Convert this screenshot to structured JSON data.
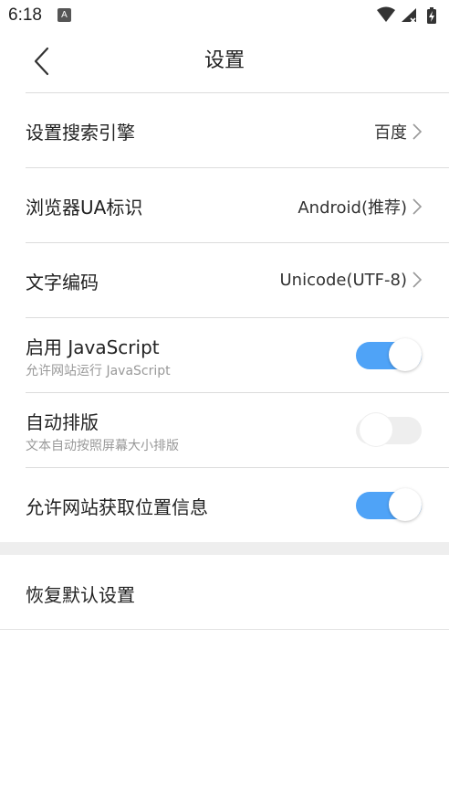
{
  "status": {
    "time": "6:18",
    "app_icon_text": "A"
  },
  "header": {
    "title": "设置"
  },
  "settings": [
    {
      "label": "设置搜索引擎",
      "value": "百度"
    },
    {
      "label": "浏览器UA标识",
      "value": "Android(推荐)"
    },
    {
      "label": "文字编码",
      "value": "Unicode(UTF-8)"
    },
    {
      "label": "启用 JavaScript",
      "sub": "允许网站运行 JavaScript",
      "enabled": true
    },
    {
      "label": "自动排版",
      "sub": "文本自动按照屏幕大小排版",
      "enabled": false
    },
    {
      "label": "允许网站获取位置信息",
      "enabled": true
    }
  ],
  "reset": {
    "label": "恢复默认设置"
  },
  "colors": {
    "toggle_on": "#4fa3f7",
    "toggle_off": "#eeeeee",
    "divider": "#dcdcdc",
    "section_gap": "#eeeeee"
  }
}
